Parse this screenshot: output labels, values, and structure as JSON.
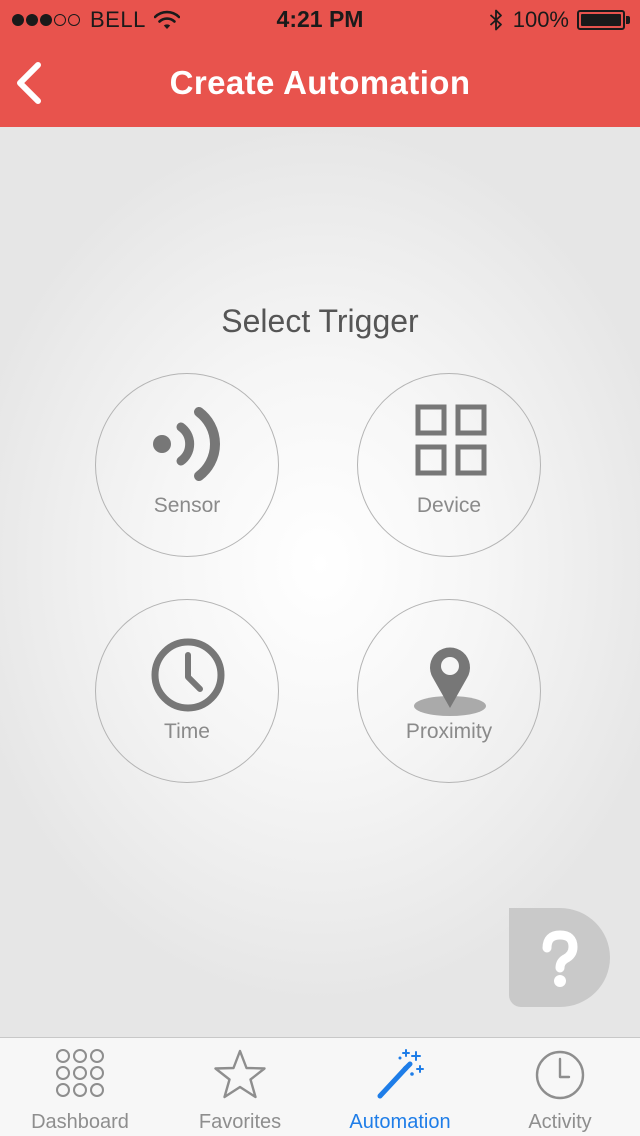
{
  "status_bar": {
    "carrier": "BELL",
    "time": "4:21 PM",
    "battery": "100%",
    "signal_bars_filled": 3,
    "signal_bars_total": 5
  },
  "nav": {
    "title": "Create Automation",
    "back_icon": "chevron-left-icon"
  },
  "main": {
    "heading": "Select Trigger",
    "triggers": [
      {
        "label": "Sensor",
        "icon": "sensor-icon"
      },
      {
        "label": "Device",
        "icon": "device-grid-icon"
      },
      {
        "label": "Time",
        "icon": "clock-icon"
      },
      {
        "label": "Proximity",
        "icon": "location-pin-icon"
      }
    ],
    "help_icon": "question-mark-icon"
  },
  "tab_bar": {
    "active_index": 2,
    "tabs": [
      {
        "label": "Dashboard",
        "icon": "dots-grid-icon"
      },
      {
        "label": "Favorites",
        "icon": "star-icon"
      },
      {
        "label": "Automation",
        "icon": "magic-wand-icon"
      },
      {
        "label": "Activity",
        "icon": "clock-icon"
      }
    ]
  },
  "colors": {
    "header": "#e8534d",
    "active_tab": "#1e7de8",
    "inactive_tab": "#8e8e8e",
    "icon_gray": "#777777"
  }
}
